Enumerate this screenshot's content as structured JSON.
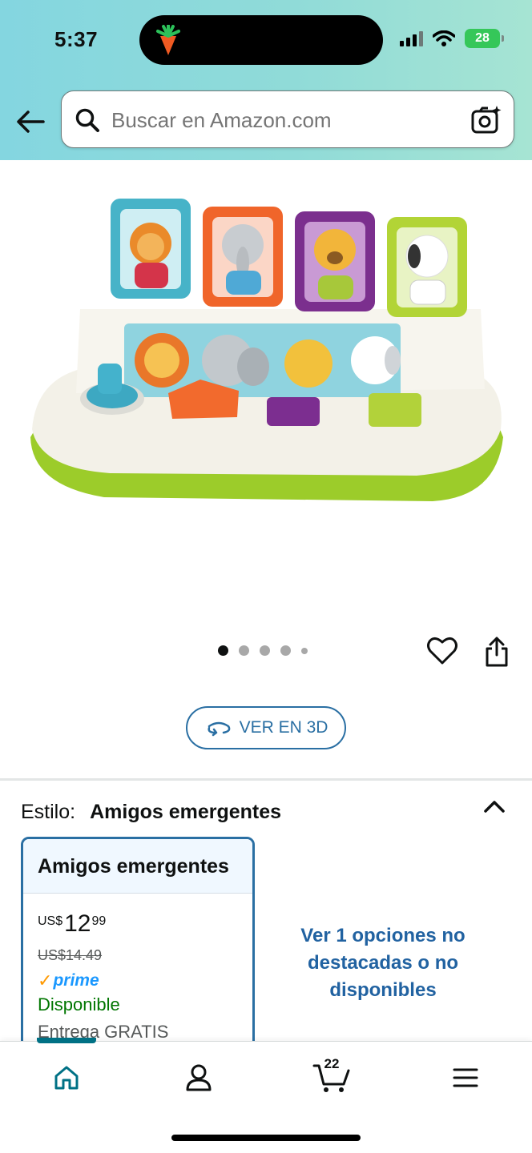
{
  "status_bar": {
    "time": "5:37",
    "battery": "28"
  },
  "search": {
    "placeholder": "Buscar en Amazon.com"
  },
  "product": {
    "image_alt": "Juguete Amigos emergentes"
  },
  "gallery": {
    "view_3d_label": "VER EN 3D"
  },
  "style": {
    "label": "Estilo:",
    "value": "Amigos emergentes"
  },
  "variant": {
    "title": "Amigos emergentes",
    "currency": "US$",
    "price_whole": "12",
    "price_cents": "99",
    "list_price": "US$14.49",
    "prime_label": "prime",
    "availability": "Disponible",
    "delivery": "Entrega GRATIS"
  },
  "more_options": {
    "label": "Ver 1 opciones no destacadas o no disponibles"
  },
  "bottom_nav": {
    "cart_count": "22"
  },
  "colors": {
    "accent_teal": "#007185",
    "link_blue": "#2162a1",
    "prime_blue": "#1a98ff",
    "available_green": "#007600",
    "card_border": "#2a6fa3"
  }
}
